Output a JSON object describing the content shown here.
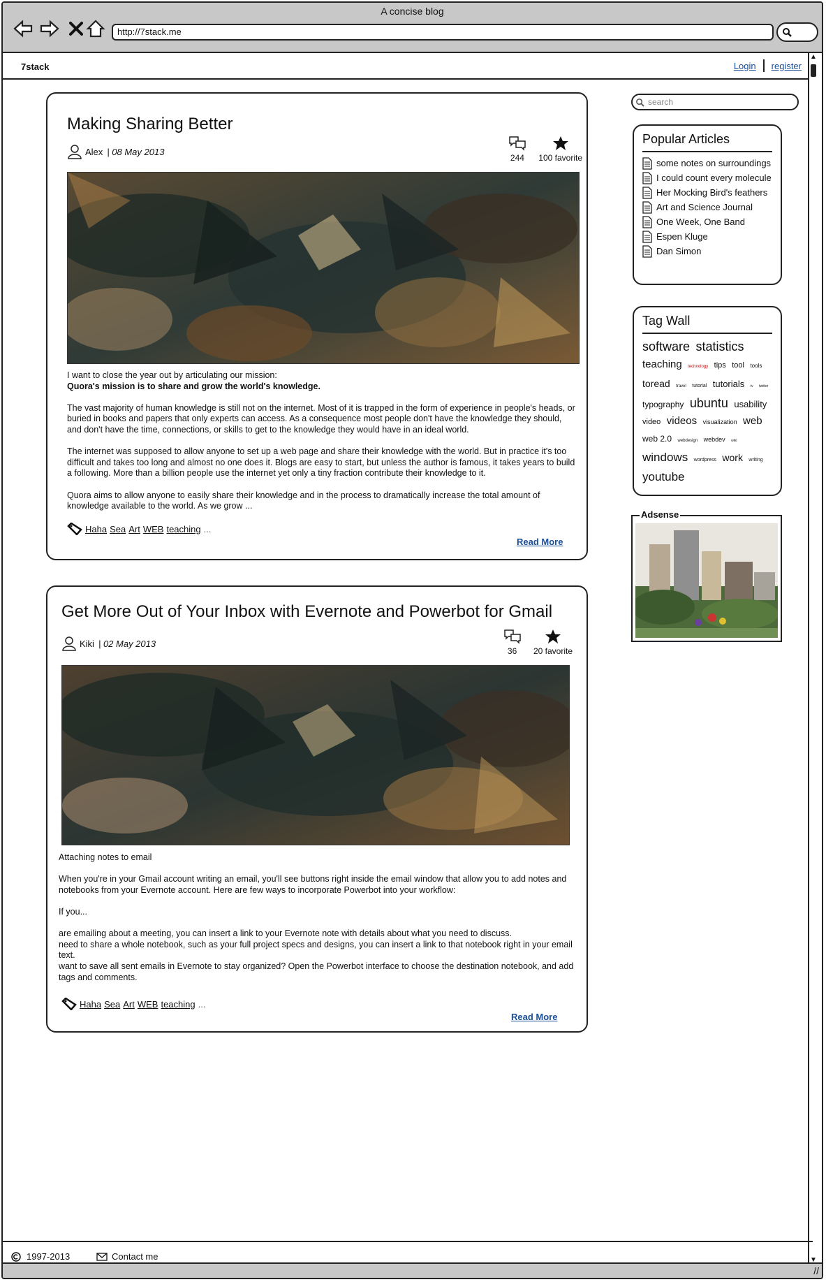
{
  "window": {
    "title": "A concise blog"
  },
  "browser": {
    "url": "http://7stack.me"
  },
  "site": {
    "brand": "7stack",
    "login": "Login",
    "register": "register"
  },
  "search": {
    "placeholder": "search"
  },
  "articles": [
    {
      "title": "Making Sharing Better",
      "author": "Alex",
      "date": "| 08 May 2013",
      "comments": "244",
      "favorites": "100 favorite",
      "paragraphs": [
        "I want to close the year out by articulating our mission:",
        "The vast majority of human knowledge is still not on the internet. Most of it is trapped in the form of experience in people's heads, or buried in books and papers that only experts can access. As a consequence most people don't have the knowledge they should, and don't have the time, connections, or skills to get to the knowledge they would have in an ideal world.",
        "The internet was supposed to allow anyone to set up a web page and share their knowledge with the world. But in practice it's too difficult and takes too long and almost no one does it. Blogs are easy to start, but unless the author is famous, it takes years to build a following. More than a billion people use the internet yet only a tiny fraction contribute their knowledge to it.",
        "Quora aims to allow anyone to easily share their knowledge and in the process to dramatically increase the total amount of knowledge available to the world. As we grow ..."
      ],
      "bold_line": "Quora's mission is to share and grow the world's knowledge.",
      "tags": [
        "Haha",
        "Sea",
        "Art",
        "WEB",
        "teaching"
      ],
      "tags_more": "...",
      "read_more": "Read More"
    },
    {
      "title": "Get More Out of Your Inbox with Evernote and Powerbot for Gmail",
      "author": "Kiki",
      "date": "| 02 May 2013",
      "comments": "36",
      "favorites": "20 favorite",
      "paragraphs": [
        "Attaching notes to email",
        "When you're in your Gmail account writing an email, you'll see buttons right inside the email window that allow you to add notes and notebooks from your Evernote account. Here are few ways to incorporate Powerbot into your workflow:",
        "If you...",
        "are emailing about a meeting, you can insert a link to your Evernote note with details about what you need to discuss.",
        "need to share a whole notebook, such as your full project specs and designs, you can insert a link to that notebook right in your email text.",
        "want to save all sent emails in Evernote to stay organized? Open the Powerbot interface to choose the destination notebook, and add tags and comments."
      ],
      "tags": [
        "Haha",
        "Sea",
        "Art",
        "WEB",
        "teaching"
      ],
      "tags_more": "...",
      "read_more": "Read More"
    }
  ],
  "popular": {
    "title": "Popular Articles",
    "items": [
      "some notes on surroundings",
      "I could count every molecule",
      "Her Mocking Bird's feathers",
      "Art and Science Journal",
      "One Week, One Band",
      "Espen Kluge",
      "Dan Simon"
    ]
  },
  "tagwall": {
    "title": "Tag Wall",
    "tags": [
      {
        "t": "software",
        "s": 18
      },
      {
        "t": "statistics",
        "s": 18
      },
      {
        "t": "teaching",
        "s": 15
      },
      {
        "t": "technology",
        "s": 6,
        "c": "#d40000"
      },
      {
        "t": "tips",
        "s": 11
      },
      {
        "t": "tool",
        "s": 11
      },
      {
        "t": "tools",
        "s": 8
      },
      {
        "t": "toread",
        "s": 14
      },
      {
        "t": "travel",
        "s": 6
      },
      {
        "t": "tutorial",
        "s": 7
      },
      {
        "t": "tutorials",
        "s": 13
      },
      {
        "t": "tv",
        "s": 5
      },
      {
        "t": "twitter",
        "s": 5
      },
      {
        "t": "typography",
        "s": 12
      },
      {
        "t": "ubuntu",
        "s": 18
      },
      {
        "t": "usability",
        "s": 13
      },
      {
        "t": "video",
        "s": 11
      },
      {
        "t": "videos",
        "s": 15
      },
      {
        "t": "visualization",
        "s": 9
      },
      {
        "t": "web",
        "s": 15
      },
      {
        "t": "web 2.0",
        "s": 12
      },
      {
        "t": "webdesign",
        "s": 6
      },
      {
        "t": "webdev",
        "s": 9
      },
      {
        "t": "wiki",
        "s": 5
      },
      {
        "t": "windows",
        "s": 17
      },
      {
        "t": "wordpress",
        "s": 7
      },
      {
        "t": "work",
        "s": 14
      },
      {
        "t": "writing",
        "s": 7
      },
      {
        "t": "youtube",
        "s": 17
      }
    ]
  },
  "adsense": {
    "label": "Adsense"
  },
  "footer": {
    "copyright": "1997-2013",
    "contact": "Contact me"
  }
}
